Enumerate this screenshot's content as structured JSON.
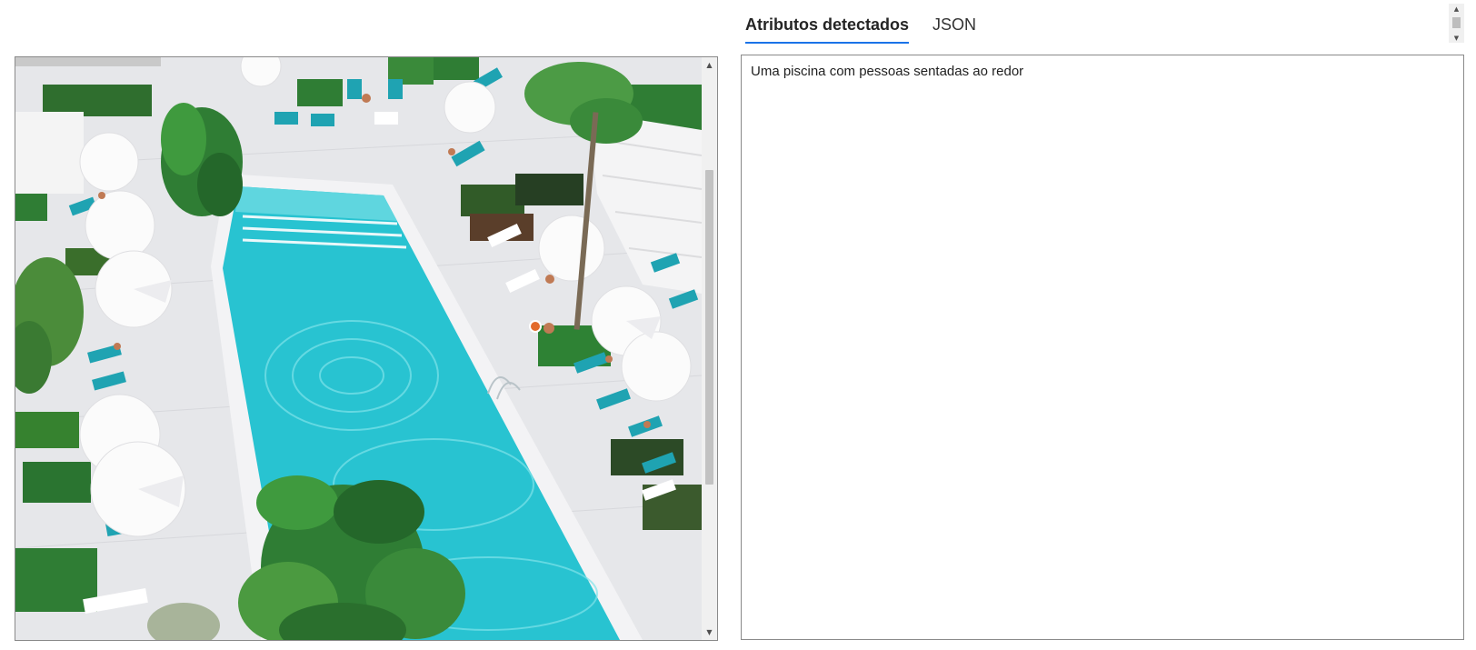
{
  "tabs": [
    {
      "label": "Atributos detectados",
      "active": true
    },
    {
      "label": "JSON",
      "active": false
    }
  ],
  "result": {
    "caption": "Uma piscina com pessoas sentadas ao redor"
  },
  "image": {
    "subject": "aerial view of a hotel swimming pool with sun loungers and umbrellas",
    "colors": {
      "pool_water": "#29c6d3",
      "deck": "#e9e9ec",
      "loungers": "#1fa3b2",
      "umbrellas": "#f7f7f7",
      "foliage": "#2f7d34"
    }
  },
  "icons": {
    "scroll_up": "chevron-up-icon",
    "scroll_down": "chevron-down-icon"
  }
}
